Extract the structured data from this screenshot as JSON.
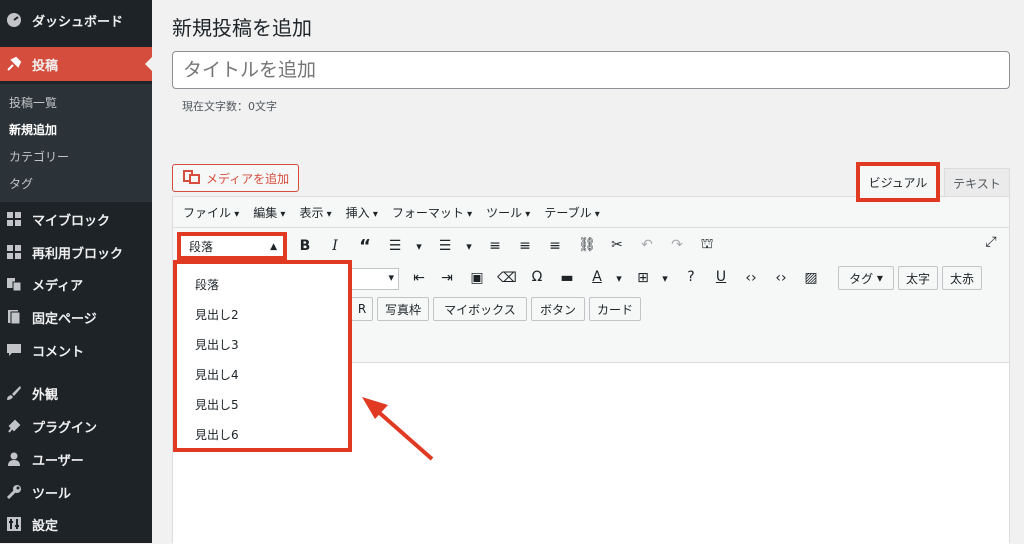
{
  "sidebar": {
    "items": [
      {
        "label": "ダッシュボード",
        "icon": "dashboard-icon"
      },
      {
        "label": "投稿",
        "icon": "pin-icon"
      },
      {
        "label": "マイブロック",
        "icon": "blocks-icon"
      },
      {
        "label": "再利用ブロック",
        "icon": "blocks-icon"
      },
      {
        "label": "メディア",
        "icon": "media-icon"
      },
      {
        "label": "固定ページ",
        "icon": "page-icon"
      },
      {
        "label": "コメント",
        "icon": "comment-icon"
      },
      {
        "label": "外観",
        "icon": "brush-icon"
      },
      {
        "label": "プラグイン",
        "icon": "plugin-icon"
      },
      {
        "label": "ユーザー",
        "icon": "user-icon"
      },
      {
        "label": "ツール",
        "icon": "wrench-icon"
      },
      {
        "label": "設定",
        "icon": "settings-icon"
      }
    ],
    "submenu": [
      "投稿一覧",
      "新規追加",
      "カテゴリー",
      "タグ"
    ]
  },
  "page": {
    "title": "新規投稿を追加",
    "title_placeholder": "タイトルを追加",
    "char_count": "現在文字数：0文字"
  },
  "editor": {
    "media_button": "メディアを追加",
    "tab_visual": "ビジュアル",
    "tab_text": "テキスト",
    "menubar": [
      "ファイル",
      "編集",
      "表示",
      "挿入",
      "フォーマット",
      "ツール",
      "テーブル"
    ],
    "format_selected": "段落",
    "format_options": [
      "段落",
      "見出し2",
      "見出し3",
      "見出し4",
      "見出し5",
      "見出し6"
    ],
    "row2_buttons": [
      "タグ",
      "太字",
      "太赤"
    ],
    "row3_buttons": [
      "R",
      "写真枠",
      "マイボックス",
      "ボタン",
      "カード"
    ]
  },
  "colors": {
    "accent": "#d54e3d",
    "highlight": "#e03a23",
    "sidebar": "#1d2327"
  }
}
